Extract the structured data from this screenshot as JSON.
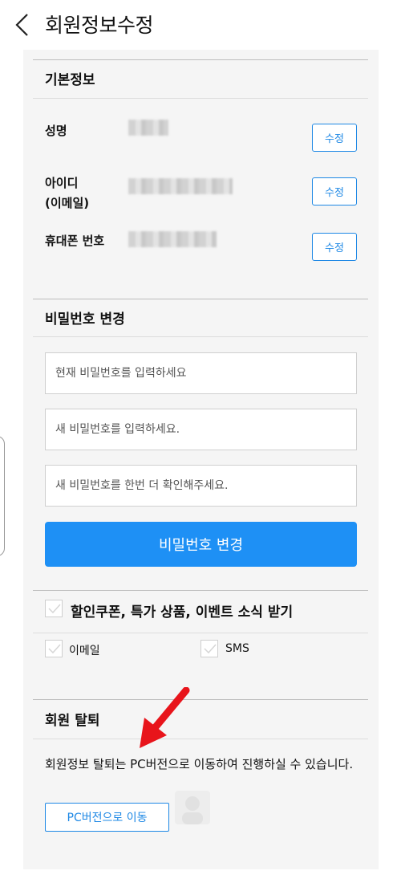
{
  "header": {
    "title": "회원정보수정",
    "back_icon": "chevron-left-icon"
  },
  "basic_info": {
    "title": "기본정보",
    "rows": [
      {
        "label_line1": "성명",
        "label_line2": "",
        "edit_label": "수정"
      },
      {
        "label_line1": "아이디",
        "label_line2": "(이메일)",
        "edit_label": "수정"
      },
      {
        "label_line1": "휴대폰 번호",
        "label_line2": "",
        "edit_label": "수정"
      }
    ]
  },
  "password": {
    "title": "비밀번호 변경",
    "current_placeholder": "현재 비밀번호를 입력하세요",
    "new_placeholder": "새 비밀번호를 입력하세요.",
    "confirm_placeholder": "새 비밀번호를 한번 더 확인해주세요.",
    "submit_label": "비밀번호 변경"
  },
  "marketing": {
    "title": "할인쿠폰, 특가 상품, 이벤트 소식 받기",
    "option_email": "이메일",
    "option_sms": "SMS",
    "checked": false
  },
  "withdraw": {
    "title": "회원 탈퇴",
    "description": "회원정보 탈퇴는 PC버전으로 이동하여 진행하실 수 있습니다.",
    "pc_button_label": "PC버전으로 이동"
  },
  "colors": {
    "accent": "#1e88e5",
    "primary_button": "#1e90f5",
    "annotation_arrow": "#e8141b"
  }
}
